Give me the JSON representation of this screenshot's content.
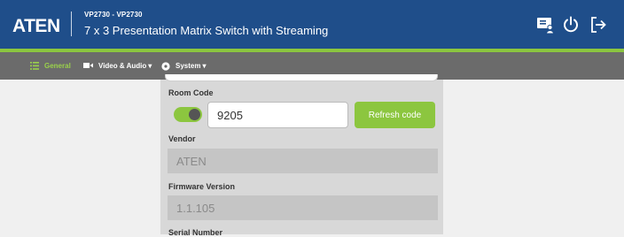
{
  "header": {
    "logo_text": "ATEN",
    "model": "VP2730 - VP2730",
    "product_name": "7 x 3 Presentation Matrix Switch with Streaming"
  },
  "colors": {
    "header_bg": "#1f4e8a",
    "accent_green": "#8cc63f",
    "nav_bg": "#6b6b6b",
    "active_nav": "#9ad14b"
  },
  "nav": {
    "items": [
      {
        "label": "General",
        "icon": "list-icon",
        "active": true
      },
      {
        "label": "Video & Audio",
        "icon": "video-icon",
        "has_dropdown": true
      },
      {
        "label": "System",
        "icon": "gear-icon",
        "has_dropdown": true
      }
    ]
  },
  "header_icons": [
    "monitor-user-icon",
    "power-icon",
    "logout-icon"
  ],
  "room_code": {
    "label": "Room Code",
    "enabled": true,
    "value": "9205",
    "refresh_label": "Refresh code"
  },
  "vendor": {
    "label": "Vendor",
    "value": "ATEN"
  },
  "firmware": {
    "label": "Firmware Version",
    "value": "1.1.105"
  },
  "serial": {
    "label": "Serial Number"
  }
}
